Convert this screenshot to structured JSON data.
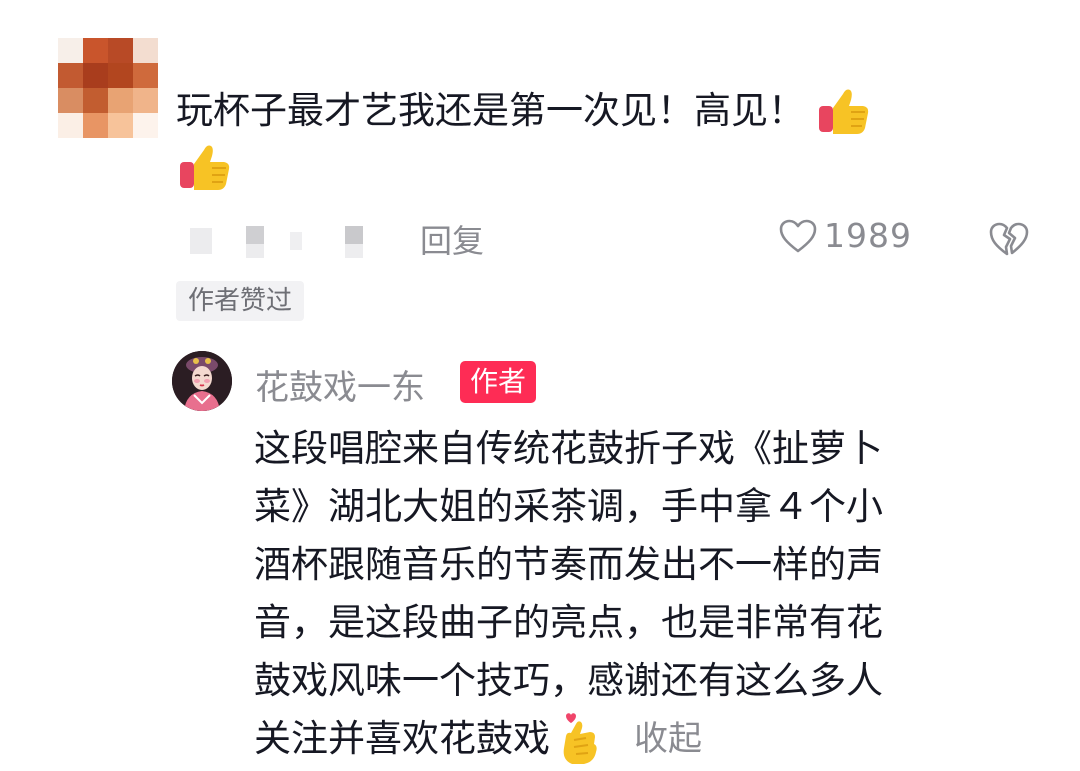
{
  "comment": {
    "text_line1": "玩杯子最才艺我还是第一次见！高见！",
    "reply_label": "回复",
    "like_count": "1989",
    "author_liked_tag": "作者赞过",
    "icons": {
      "thumbs_up": "thumbs-up-icon",
      "like": "heart-outline-icon",
      "dislike": "broken-heart-icon"
    }
  },
  "author_reply": {
    "name": "花鼓戏一东",
    "badge": "作者",
    "lines": [
      "这段唱腔来自传统花鼓折子戏《扯萝卜",
      "菜》湖北大姐的采茶调，手中拿４个小",
      "酒杯跟随音乐的节奏而发出不一样的声",
      "音，是这段曲子的亮点，也是非常有花",
      "鼓戏风味一个技巧，感谢还有这么多人",
      "关注并喜欢花鼓戏"
    ],
    "emoji": "fingers-crossed-heart-icon",
    "collapse_label": "收起"
  },
  "colors": {
    "accent": "#fe2c55",
    "text_primary": "#161823",
    "text_secondary": "#8a8b91",
    "tag_bg": "#f2f2f4"
  }
}
